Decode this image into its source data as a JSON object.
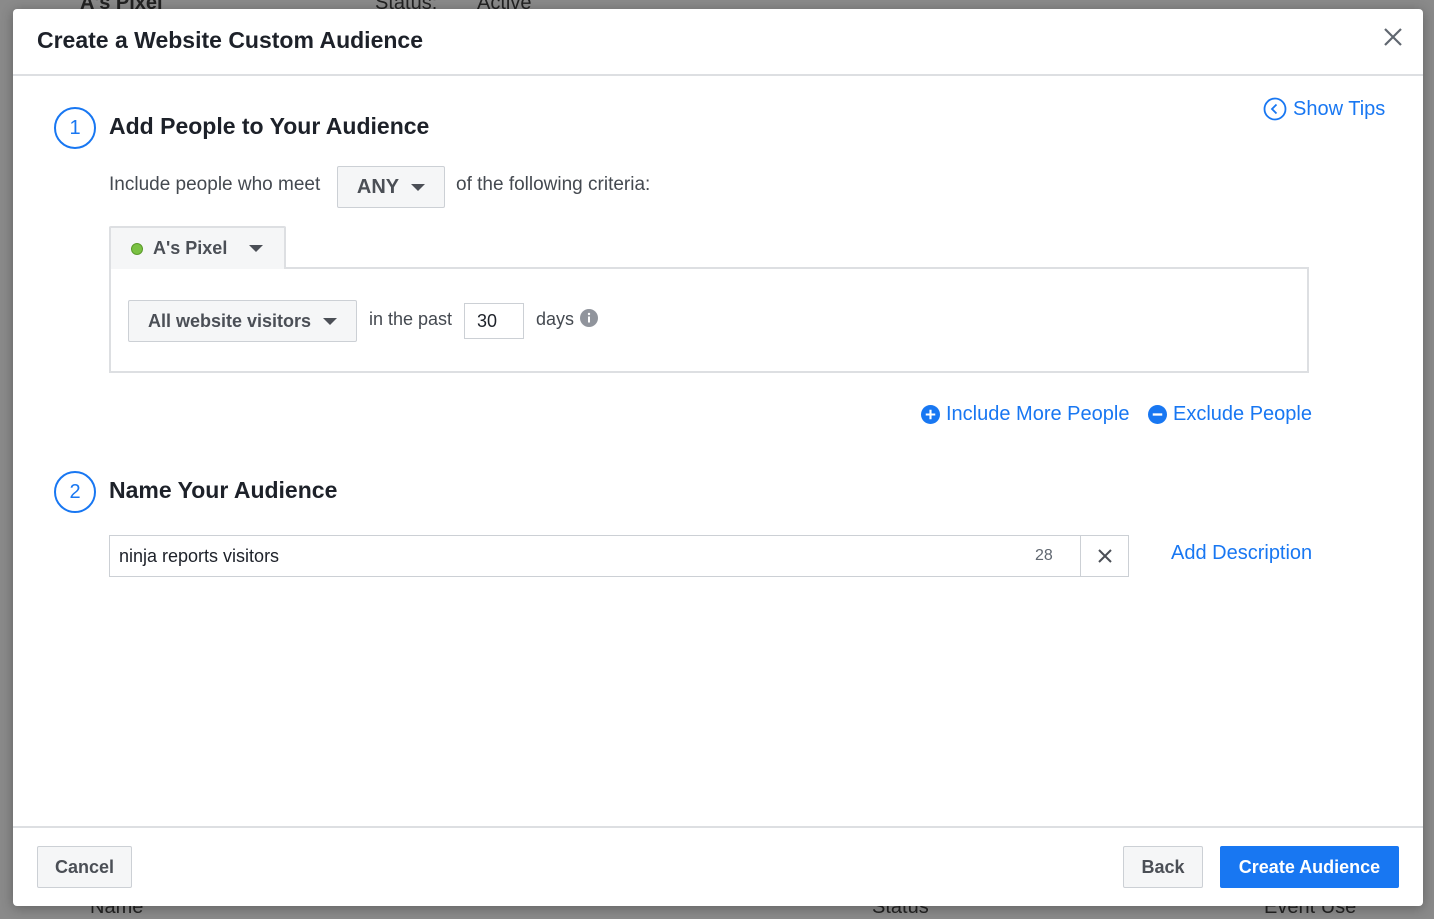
{
  "background": {
    "pixel_name": "A's Pixel",
    "status_label": "Status:",
    "status_value": "Active",
    "col_name": "Name",
    "col_status": "Status",
    "col_event_use": "Event Use"
  },
  "modal": {
    "title": "Create a Website Custom Audience",
    "show_tips": "Show Tips"
  },
  "step1": {
    "number": "1",
    "title": "Add People to Your Audience",
    "include_prefix": "Include people who meet",
    "match_value": "ANY",
    "include_suffix": "of the following criteria:",
    "pixel": "A's Pixel",
    "pixel_status_color": "#7ac143",
    "event": "All website visitors",
    "in_the_past": "in the past",
    "days_value": "30",
    "days_label": "days",
    "include_more": "Include More People",
    "exclude": "Exclude People"
  },
  "step2": {
    "number": "2",
    "title": "Name Your Audience",
    "name_value": "ninja reports visitors",
    "char_remaining": "28",
    "add_description": "Add Description"
  },
  "footer": {
    "cancel": "Cancel",
    "back": "Back",
    "create": "Create Audience"
  },
  "colors": {
    "accent": "#1877f2"
  }
}
